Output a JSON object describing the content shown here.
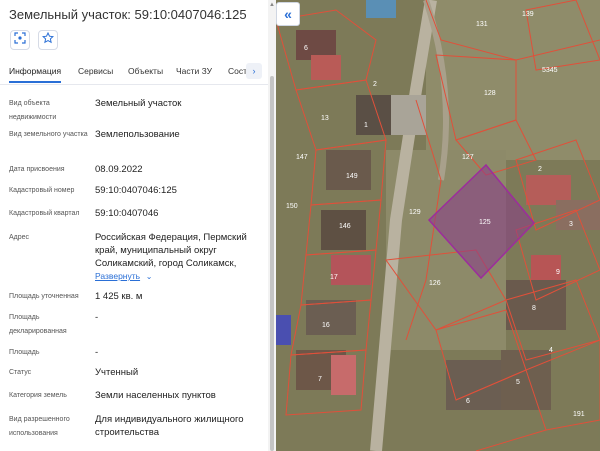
{
  "header": {
    "title": "Земельный участок: 59:10:0407046:125"
  },
  "tabs": [
    {
      "label": "Информация"
    },
    {
      "label": "Сервисы"
    },
    {
      "label": "Объекты"
    },
    {
      "label": "Части ЗУ"
    },
    {
      "label": "Соста"
    }
  ],
  "info": {
    "object_type_label": "Вид объекта недвижимости",
    "object_type_value": "Земельный участок",
    "land_type_label": "Вид земельного участка",
    "land_type_value": "Землепользование",
    "assign_date_label": "Дата присвоения",
    "assign_date_value": "08.09.2022",
    "cadastral_number_label": "Кадастровый номер",
    "cadastral_number_value": "59:10:0407046:125",
    "cadastral_quarter_label": "Кадастровый квартал",
    "cadastral_quarter_value": "59:10:0407046",
    "address_label": "Адрес",
    "address_value": "Российская Федерация, Пермский край, муниципальный округ Соликамский, город Соликамск,",
    "expand_link": "Развернуть",
    "area_refined_label": "Площадь уточненная",
    "area_refined_value": "1 425 кв. м",
    "area_declared_label": "Площадь декларированная",
    "area_declared_value": "-",
    "area_label": "Площадь",
    "area_value": "-",
    "status_label": "Статус",
    "status_value": "Учтенный",
    "category_label": "Категория земель",
    "category_value": "Земли населенных пунктов",
    "permitted_use_label": "Вид разрешенного использования",
    "permitted_use_value": "Для индивидуального жилищного строительства"
  },
  "map": {
    "parcel_labels": [
      "131",
      "139",
      "6",
      "5345",
      "2",
      "128",
      "13",
      "1",
      "127",
      "147",
      "149",
      "2",
      "150",
      "129",
      "125",
      "146",
      "3",
      "9",
      "126",
      "17",
      "8",
      "16",
      "4",
      "7",
      "5",
      "6",
      "191"
    ],
    "selected_parcel": "125",
    "selected_color": "#8b3a8b",
    "boundary_color": "#e0503a"
  }
}
